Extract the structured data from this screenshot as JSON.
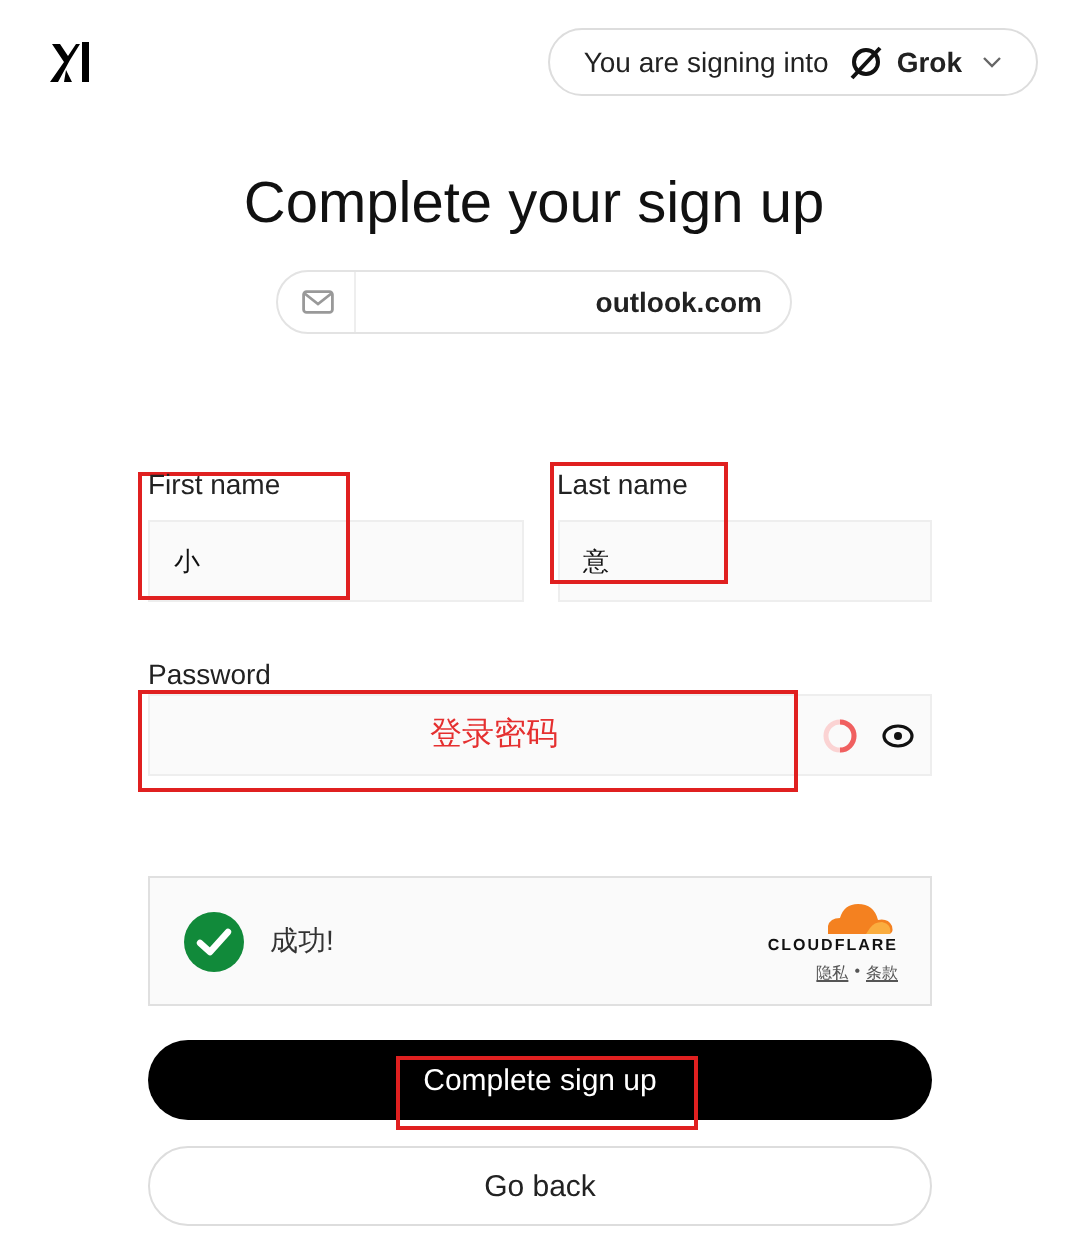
{
  "header": {
    "context_label": "You are signing into",
    "app_name": "Grok"
  },
  "title": "Complete your sign up",
  "email": {
    "value": "outlook.com"
  },
  "fields": [
    {
      "label": "First name",
      "value": "小"
    },
    {
      "label": "Last name",
      "value": "意"
    }
  ],
  "password": {
    "label": "Password",
    "annotation": "登录密码"
  },
  "captcha": {
    "status": "成功!",
    "verified": true,
    "brand": "CLOUDFLARE",
    "links": [
      "隐私",
      "条款"
    ],
    "separator": "•"
  },
  "buttons": [
    {
      "label": "Complete sign up",
      "kind": "primary"
    },
    {
      "label": "Go back",
      "kind": "secondary"
    }
  ]
}
